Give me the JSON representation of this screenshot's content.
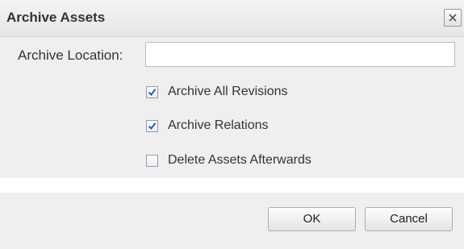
{
  "dialog": {
    "title": "Archive Assets",
    "close_icon": "close-icon"
  },
  "form": {
    "location_label": "Archive Location:",
    "location_value": "",
    "options": [
      {
        "label": "Archive All Revisions",
        "checked": true
      },
      {
        "label": "Archive Relations",
        "checked": true
      },
      {
        "label": "Delete Assets Afterwards",
        "checked": false
      }
    ]
  },
  "buttons": {
    "ok_label": "OK",
    "cancel_label": "Cancel"
  },
  "colors": {
    "panel": "#efefef",
    "checkmark": "#2a5cb8"
  }
}
